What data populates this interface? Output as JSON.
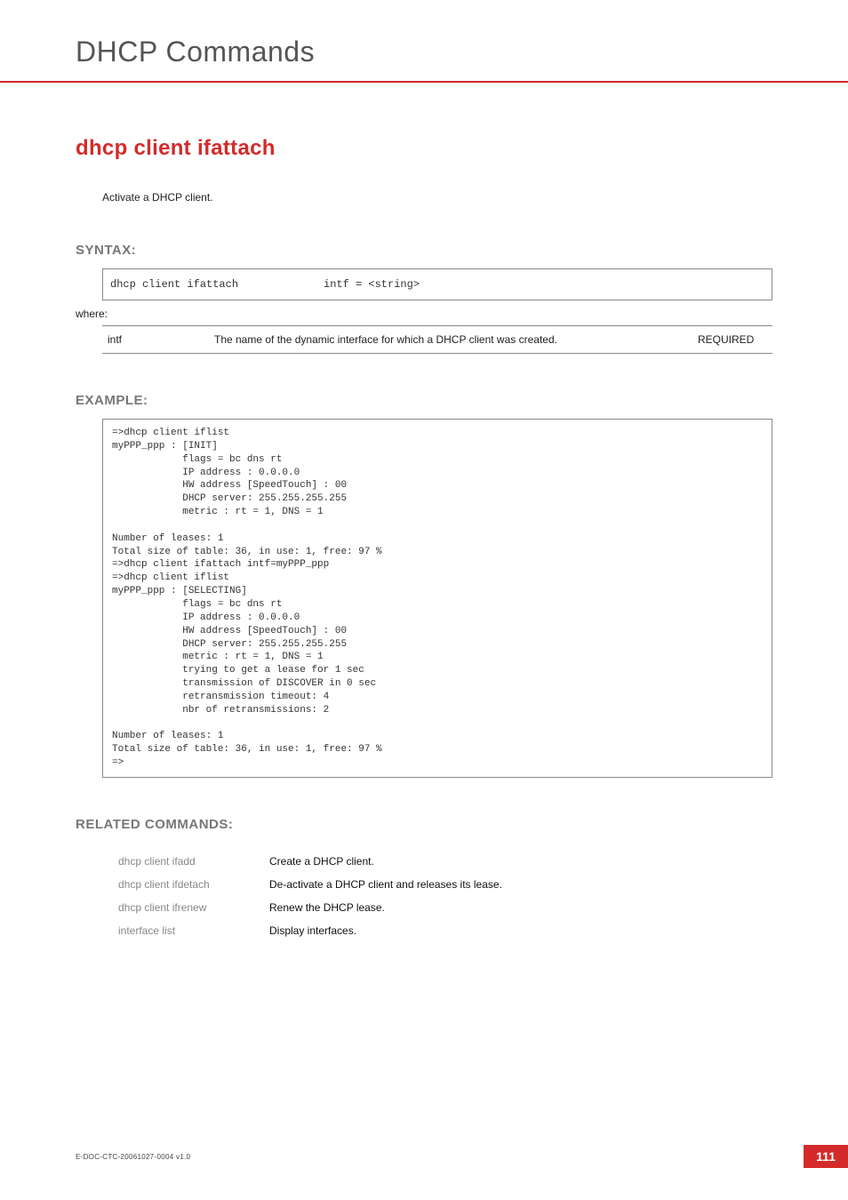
{
  "chapter": {
    "title": "DHCP Commands"
  },
  "section": {
    "title": "dhcp client ifattach",
    "description": "Activate a DHCP client."
  },
  "syntax": {
    "label": "SYNTAX:",
    "command": "dhcp client ifattach",
    "args": "intf = <string>",
    "where": "where:",
    "params": [
      {
        "name": "intf",
        "desc": "The name of the dynamic interface for which a DHCP client was created.",
        "req": "REQUIRED"
      }
    ]
  },
  "example": {
    "label": "EXAMPLE:",
    "text": "=>dhcp client iflist\nmyPPP_ppp : [INIT]\n            flags = bc dns rt\n            IP address : 0.0.0.0\n            HW address [SpeedTouch] : 00\n            DHCP server: 255.255.255.255\n            metric : rt = 1, DNS = 1\n\nNumber of leases: 1\nTotal size of table: 36, in use: 1, free: 97 %\n=>dhcp client ifattach intf=myPPP_ppp\n=>dhcp client iflist\nmyPPP_ppp : [SELECTING]\n            flags = bc dns rt\n            IP address : 0.0.0.0\n            HW address [SpeedTouch] : 00\n            DHCP server: 255.255.255.255\n            metric : rt = 1, DNS = 1\n            trying to get a lease for 1 sec\n            transmission of DISCOVER in 0 sec\n            retransmission timeout: 4\n            nbr of retransmissions: 2\n\nNumber of leases: 1\nTotal size of table: 36, in use: 1, free: 97 %\n=>"
  },
  "related": {
    "label": "RELATED COMMANDS:",
    "items": [
      {
        "cmd": "dhcp client ifadd",
        "desc": "Create a DHCP client."
      },
      {
        "cmd": "dhcp client ifdetach",
        "desc": "De-activate a DHCP client and releases its lease."
      },
      {
        "cmd": "dhcp client ifrenew",
        "desc": "Renew the DHCP lease."
      },
      {
        "cmd": "interface list",
        "desc": "Display interfaces."
      }
    ]
  },
  "footer": {
    "docref": "E-DOC-CTC-20061027-0004 v1.0",
    "pagenum": "111"
  }
}
